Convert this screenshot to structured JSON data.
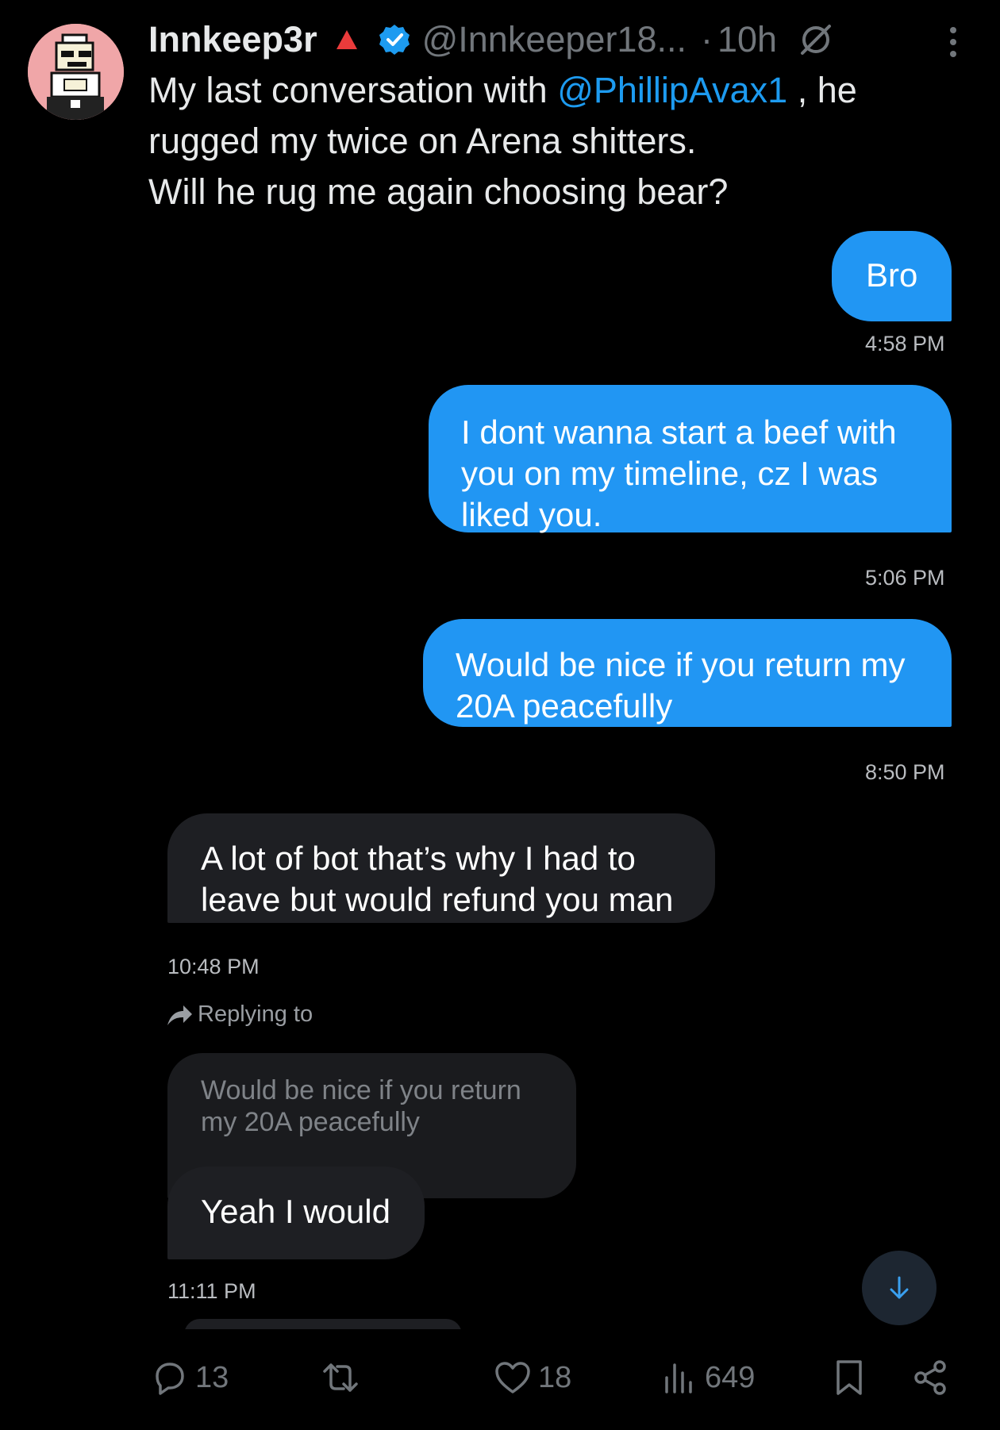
{
  "author": {
    "name": "Innkeep3r",
    "handle": "@Innkeeper18...",
    "dot": "·",
    "time_ago": "10h"
  },
  "tweet": {
    "line1_pre": "My last conversation with ",
    "line1_mention": "@PhillipAvax1",
    "line1_post": " , he",
    "line2": "rugged my twice on Arena shitters.",
    "line3": "Will he rug me again choosing bear?"
  },
  "chat": {
    "messages": [
      {
        "text": "Bro",
        "time": "4:58 PM"
      },
      {
        "text": "I dont wanna start a beef with you on my timeline, cz I was liked you.",
        "time": "5:06 PM"
      },
      {
        "text": "Would be nice if you return my 20A peacefully",
        "time": "8:50 PM"
      },
      {
        "text": "A lot of bot that’s why I had to leave but would refund you man",
        "time": "10:48 PM"
      }
    ],
    "replying_label": "Replying to",
    "quoted_text": "Would be nice if you return my 20A peacefully",
    "reply_text": "Yeah I would",
    "reply_time": "11:11 PM"
  },
  "actions": {
    "replies": "13",
    "likes": "18",
    "views": "649"
  },
  "colors": {
    "accent": "#1d9bf0",
    "outgoing_bubble": "#2196f3",
    "incoming_bubble": "#1e1f23",
    "muted": "#71767b"
  }
}
